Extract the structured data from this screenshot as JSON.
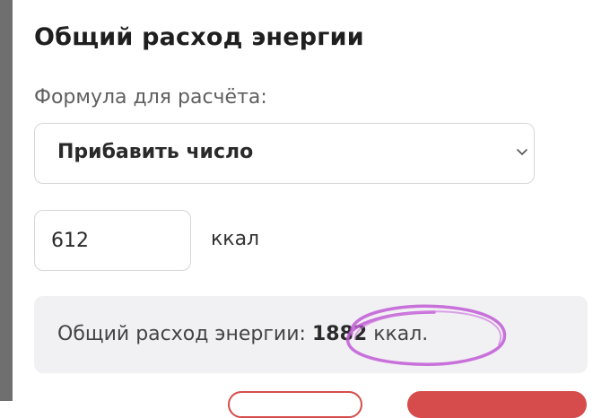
{
  "title": "Общий расход энергии",
  "formula": {
    "label": "Формула для расчёта:",
    "selected": "Прибавить число",
    "icon": "chevron-down-icon"
  },
  "amount": {
    "value": "612",
    "unit": "ккал"
  },
  "result": {
    "label": "Общий расход энергии:",
    "value": "1882",
    "unit": "ккал."
  },
  "colors": {
    "highlight": "#c15bd6",
    "accent_red": "#d64b4b",
    "result_bg": "#f1f1f3"
  }
}
